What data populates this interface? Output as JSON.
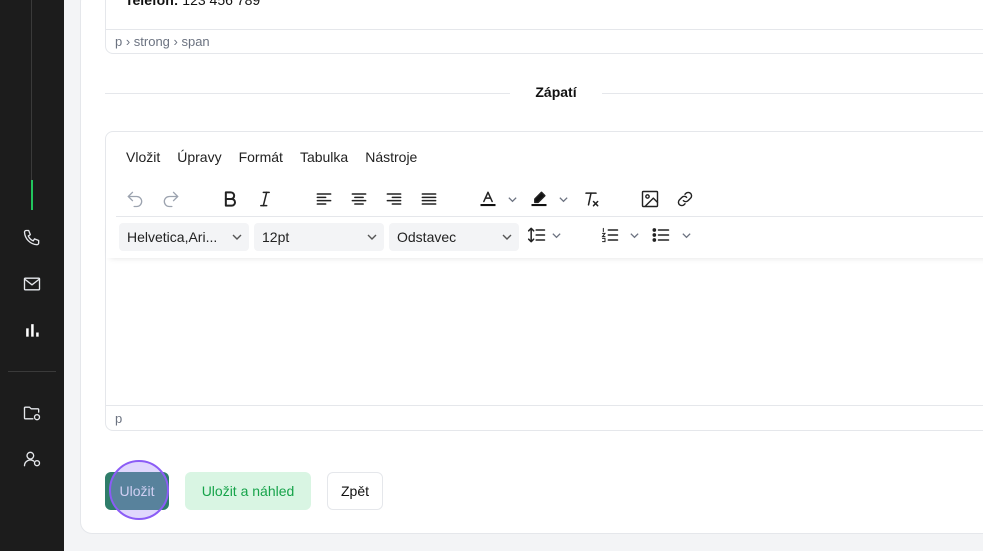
{
  "sidebar": {
    "icons": [
      "phone-icon",
      "mail-icon",
      "bar-chart-icon",
      "folder-settings-icon",
      "user-settings-icon"
    ]
  },
  "top_editor": {
    "text_strong": "Telefon:",
    "text_value": " 123 456 789",
    "statusbar_path": "p › strong › span"
  },
  "section": {
    "title": "Zápatí"
  },
  "editor": {
    "menu": [
      "Vložit",
      "Úpravy",
      "Formát",
      "Tabulka",
      "Nástroje"
    ],
    "font_family": "Helvetica,Ari...",
    "font_size": "12pt",
    "block_format": "Odstavec",
    "statusbar_path": "p"
  },
  "buttons": {
    "save": "Uložit",
    "save_preview": "Uložit a náhled",
    "back": "Zpět"
  },
  "colors": {
    "accent": "#22c55e",
    "save_bg": "#2f7d6a",
    "save_preview_bg": "#d9f5e3",
    "sidebar_bg": "#1c1c1c"
  }
}
